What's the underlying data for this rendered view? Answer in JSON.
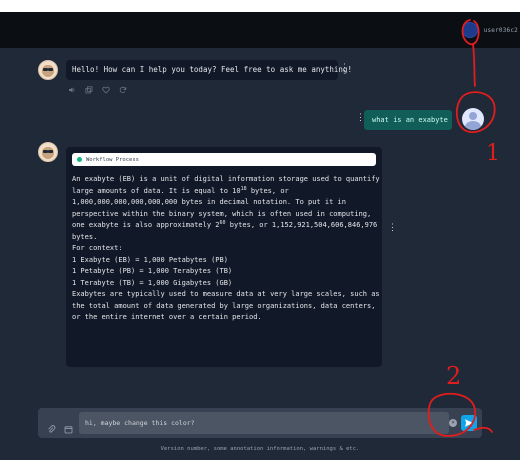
{
  "header": {
    "username": "user036c2"
  },
  "greeting": {
    "text": "Hello! How can I help you today? Feel free to ask me anything!"
  },
  "user_message": {
    "text": "what is an exabyte"
  },
  "answer": {
    "workflow_label": "Workflow Process",
    "line1": "An exabyte (EB) is a unit of digital information storage used to quantify",
    "line2_pre": "large amounts of data. It is equal to 10",
    "line2_sup": "18",
    "line2_post": " bytes, or",
    "line3": "1,000,000,000,000,000,000 bytes in decimal notation. To put it in",
    "line4": "perspective within the binary system, which is often used in computing,",
    "line5_pre": "one exabyte is also approximately 2",
    "line5_sup": "60",
    "line5_post": " bytes, or 1,152,921,504,606,846,976",
    "line6": "bytes.",
    "line7": "For context:",
    "line8": "1 Exabyte (EB) = 1,000 Petabytes (PB)",
    "line9": "1 Petabyte (PB) = 1,000 Terabytes (TB)",
    "line10": "1 Terabyte (TB) = 1,000 Gigabytes (GB)",
    "line11": "Exabytes are typically used to measure data at very large scales, such as",
    "line12": "the total amount of data generated by large organizations, data centers,",
    "line13": "or the entire internet over a certain period."
  },
  "composer": {
    "value": "hi, maybe change this color?",
    "placeholder": ""
  },
  "footer": {
    "text": "Version number, some annotation information, warnings & etc."
  },
  "annotations": {
    "mark1": "1",
    "mark2": "2"
  },
  "colors": {
    "annotation": "#e11d1d",
    "send_button": "#0ea5e9",
    "user_bubble": "#115e59"
  }
}
